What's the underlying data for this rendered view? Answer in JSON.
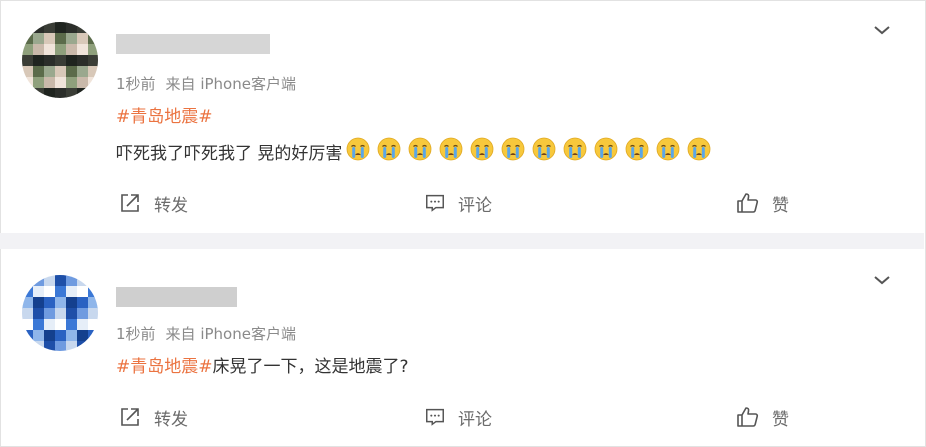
{
  "posts": [
    {
      "meta_time": "1秒前",
      "meta_source": "来自 iPhone客户端",
      "hashtag": "#青岛地震#",
      "text": "吓死我了吓死我了 晃的好厉害",
      "emoji_icon": "crying-face-icon",
      "emoji_count": 12,
      "actions": {
        "forward": "转发",
        "comment": "评论",
        "like": "赞"
      }
    },
    {
      "meta_time": "1秒前",
      "meta_source": "来自 iPhone客户端",
      "hashtag": "#青岛地震#",
      "text": "床晃了一下，这是地震了?",
      "actions": {
        "forward": "转发",
        "comment": "评论",
        "like": "赞"
      }
    }
  ],
  "colors": {
    "hashtag": "#eb7340",
    "meta": "#8a8a8a",
    "separator_band": "#f2f2f5"
  }
}
